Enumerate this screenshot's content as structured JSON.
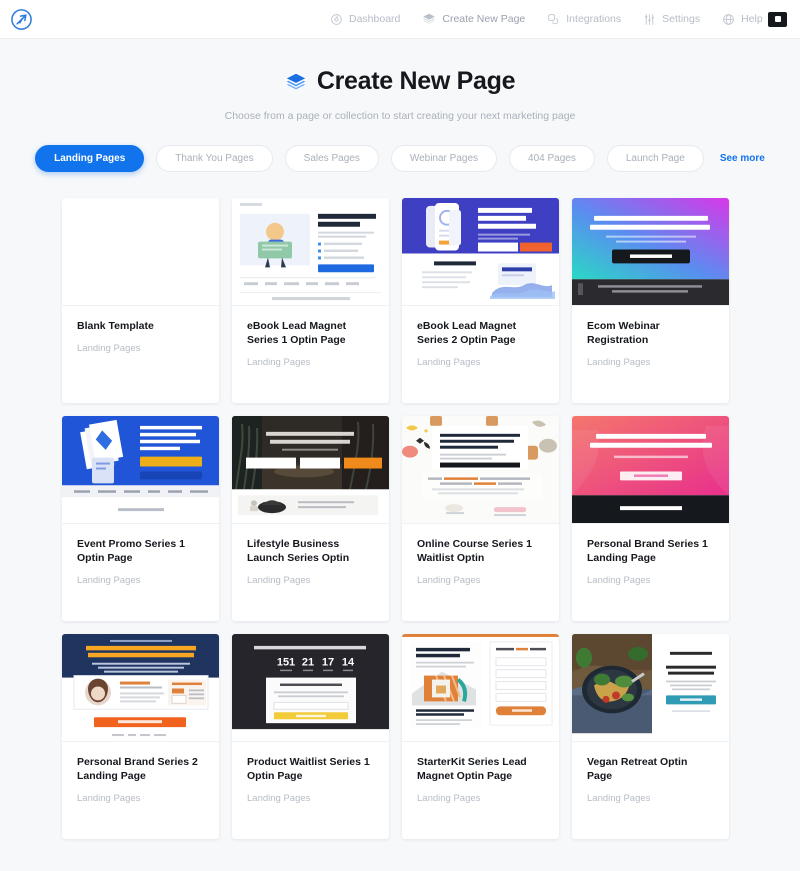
{
  "topbar": {
    "logo_icon": "rocket-logo-icon",
    "nav": [
      {
        "label": "Dashboard",
        "icon": "dashboard-icon",
        "active": false
      },
      {
        "label": "Create New Page",
        "icon": "layers-icon",
        "active": true
      },
      {
        "label": "Integrations",
        "icon": "integrations-icon",
        "active": false
      },
      {
        "label": "Settings",
        "icon": "sliders-icon",
        "active": false
      },
      {
        "label": "Help",
        "icon": "help-globe-icon",
        "active": false
      }
    ],
    "account_button_icon": "account-avatar-icon"
  },
  "header": {
    "icon": "layers-icon",
    "title": "Create New Page",
    "subtitle": "Choose from a page or collection to start creating your next marketing page"
  },
  "filters": {
    "pills": [
      {
        "label": "Landing Pages",
        "active": true
      },
      {
        "label": "Thank You Pages",
        "active": false
      },
      {
        "label": "Sales Pages",
        "active": false
      },
      {
        "label": "Webinar Pages",
        "active": false
      },
      {
        "label": "404 Pages",
        "active": false
      },
      {
        "label": "Launch Page",
        "active": false
      }
    ],
    "see_more": "See more"
  },
  "colors": {
    "accent": "#1274ec",
    "page_bg": "#f7f8fa",
    "card_bg": "#ffffff",
    "title_text": "#15181d",
    "muted_text": "#b6bcc6"
  },
  "templates": [
    {
      "title": "Blank Template",
      "category": "Landing Pages",
      "thumb": "blank"
    },
    {
      "title": "eBook Lead Magnet Series 1 Optin Page",
      "category": "Landing Pages",
      "thumb": "ebook1"
    },
    {
      "title": "eBook Lead Magnet Series 2 Optin Page",
      "category": "Landing Pages",
      "thumb": "ebook2"
    },
    {
      "title": "Ecom Webinar Registration",
      "category": "Landing Pages",
      "thumb": "ecom"
    },
    {
      "title": "Event Promo Series 1 Optin Page",
      "category": "Landing Pages",
      "thumb": "event"
    },
    {
      "title": "Lifestyle Business Launch Series Optin",
      "category": "Landing Pages",
      "thumb": "lifestyle"
    },
    {
      "title": "Online Course Series 1 Waitlist Optin",
      "category": "Landing Pages",
      "thumb": "course"
    },
    {
      "title": "Personal Brand Series 1 Landing Page",
      "category": "Landing Pages",
      "thumb": "brand1"
    },
    {
      "title": "Personal Brand Series 2 Landing Page",
      "category": "Landing Pages",
      "thumb": "brand2"
    },
    {
      "title": "Product Waitlist Series 1 Optin Page",
      "category": "Landing Pages",
      "thumb": "waitlist"
    },
    {
      "title": "StarterKit Series Lead Magnet Optin Page",
      "category": "Landing Pages",
      "thumb": "starterkit"
    },
    {
      "title": "Vegan Retreat Optin Page",
      "category": "Landing Pages",
      "thumb": "vegan"
    }
  ],
  "thumb_text": {
    "ebook1_heading": "Landing Page Conversion Secrets Download",
    "ebook1_footer": "Learn from the most trusted names creating Landing Pages and",
    "ebook2_heading": "Discover The Secrets to Building Profitable Software",
    "ebook2_sub": "Your First Subhead",
    "ecom_heading": "Let Me Show You How to Build an Ecommerce Business From Scratch",
    "ecom_button": "YES, RESERVE MY SPOT",
    "event_heading": "Get the EXACT Blueprint I Use to Sell Out Events & Have Sponsors Begging You for a Speaking Slot",
    "event_section": "About The Author",
    "lifestyle_heading": "The 3-Step Formula to A Successful Lifestyle Business",
    "course_heading": "Join the Waitlist Now for Early Beta Access to Our Essential Course on Ecomm Business",
    "brand1_heading": "Let me show you how to supercharge your marketing",
    "brand1_bar": "Are you missing out on",
    "brand2_heading": "How I Create & Scale Personal Brands to 6 Figures Like Clockwork",
    "waitlist_heading": "Get the fast-track on our brand new product",
    "waitlist_counter": [
      "151",
      "21",
      "17",
      "14"
    ],
    "starterkit_heading": "Get the Conversion Design StarterKit",
    "vegan_heading": "SUMMER RETREAT"
  }
}
